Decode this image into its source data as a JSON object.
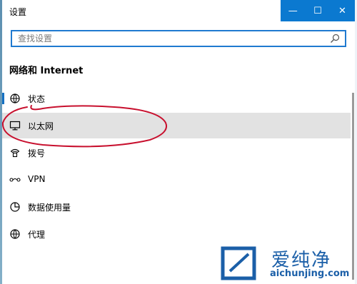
{
  "window": {
    "title": "设置"
  },
  "controls": {
    "minimize_glyph": "—",
    "maximize_glyph": "☐",
    "close_glyph": "✕"
  },
  "search": {
    "placeholder": "查找设置",
    "icon": "search-icon"
  },
  "section": {
    "title": "网络和 Internet"
  },
  "nav": {
    "items": [
      {
        "label": "状态",
        "icon": "status-globe-icon",
        "active": true,
        "selected": false
      },
      {
        "label": "以太网",
        "icon": "ethernet-monitor-icon",
        "active": false,
        "selected": true
      },
      {
        "label": "拨号",
        "icon": "dialup-phone-icon",
        "active": false,
        "selected": false
      },
      {
        "label": "VPN",
        "icon": "vpn-icon",
        "active": false,
        "selected": false
      },
      {
        "label": "数据使用量",
        "icon": "data-usage-icon",
        "active": false,
        "selected": false
      },
      {
        "label": "代理",
        "icon": "proxy-globe-icon",
        "active": false,
        "selected": false
      }
    ]
  },
  "colors": {
    "accent": "#0b79d0",
    "selected_bg": "#e2e2e2",
    "annotation": "#c8102e",
    "watermark": "#1b5fa8"
  },
  "watermark": {
    "name": "爱纯净",
    "url": "aichunjing.com"
  }
}
